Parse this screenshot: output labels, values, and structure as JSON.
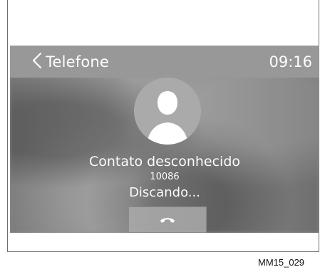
{
  "header": {
    "title": "Telefone",
    "time": "09:16"
  },
  "call": {
    "contact_name": "Contato desconhecido",
    "number": "10086",
    "status": "Discando..."
  },
  "icons": {
    "back": "chevron-left-icon",
    "avatar": "person-silhouette-icon",
    "end_call": "phone-hangup-icon"
  },
  "caption": {
    "code": "MM15_029"
  },
  "colors": {
    "header": "#989898",
    "background": "#8f8f8f",
    "text": "#ffffff",
    "frame": "#6e6e6e"
  }
}
